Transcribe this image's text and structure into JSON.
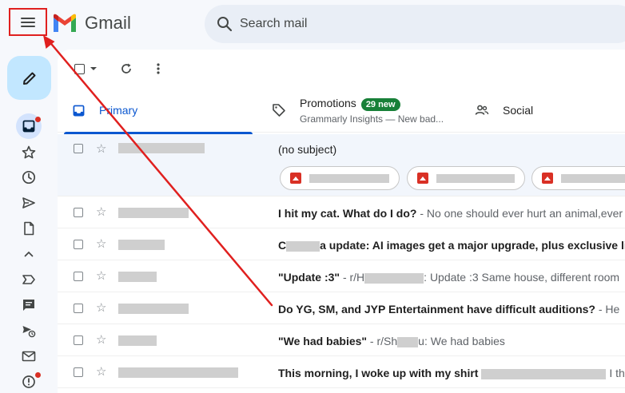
{
  "header": {
    "app_name": "Gmail",
    "search_placeholder": "Search mail"
  },
  "tabs": [
    {
      "label": "Primary",
      "active": true
    },
    {
      "label": "Promotions",
      "badge": "29 new",
      "sub": "Grammarly Insights — New bad..."
    },
    {
      "label": "Social"
    }
  ],
  "emails": [
    {
      "subject": "(no subject)",
      "snippet": "",
      "unread": false
    },
    {
      "subject": "I hit my cat. What do I do?",
      "snippet": " - No one should ever hurt an animal,ever"
    },
    {
      "subject_pre": "C",
      "subject_post": "a update: AI images get a major upgrade, plus exclusive li",
      "snippet": ""
    },
    {
      "subject": "\"Update :3\"",
      "snippet_pre": " - r/H",
      "snippet_post": ": Update :3 Same house, different room"
    },
    {
      "subject": "Do YG, SM, and JYP Entertainment have difficult auditions?",
      "snippet": " - He"
    },
    {
      "subject": "\"We had babies\"",
      "snippet_pre": " - r/Sh",
      "snippet_post": "u: We had babies"
    },
    {
      "subject": "This morning, I woke up with my shirt",
      "snippet": " I th"
    }
  ],
  "colors": {
    "accent": "#0b57d0",
    "compose_bg": "#c2e7ff",
    "annotation": "#e0201f",
    "badge": "#188038"
  }
}
